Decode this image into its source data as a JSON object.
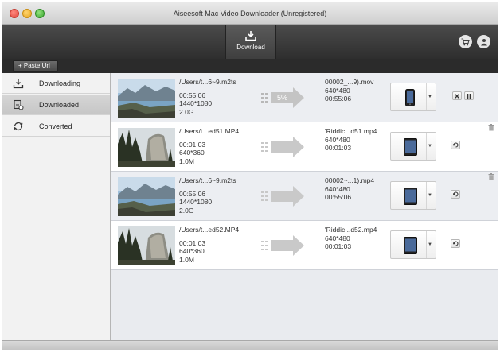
{
  "window": {
    "title": "Aiseesoft Mac Video Downloader (Unregistered)"
  },
  "toolbar": {
    "download_label": "Download"
  },
  "urlbar": {
    "paste_label": "Paste Url"
  },
  "sidebar": {
    "items": [
      {
        "label": "Downloading",
        "icon": "download-icon"
      },
      {
        "label": "Downloaded",
        "icon": "downloaded-icon"
      },
      {
        "label": "Converted",
        "icon": "convert-icon"
      }
    ],
    "active_index": 1
  },
  "rows": [
    {
      "thumb": "lake",
      "src": {
        "name": "/Users/t...6~9.m2ts",
        "duration": "00:55:06",
        "resolution": "1440*1080",
        "size": "2.0G"
      },
      "progress": "5%",
      "dst": {
        "name": "00002_...9).mov",
        "resolution": "640*480",
        "duration": "00:55:06"
      },
      "device": "iphone",
      "actions": [
        "stop",
        "pause"
      ],
      "deletable": false
    },
    {
      "thumb": "forest",
      "src": {
        "name": "/Users/t...ed51.MP4",
        "duration": "00:01:03",
        "resolution": "640*360",
        "size": "1.0M"
      },
      "progress": "",
      "dst": {
        "name": "'Riddic...d51.mp4",
        "resolution": "640*480",
        "duration": "00:01:03"
      },
      "device": "ipad",
      "actions": [
        "convert"
      ],
      "deletable": true
    },
    {
      "thumb": "lake",
      "src": {
        "name": "/Users/t...6~9.m2ts",
        "duration": "00:55:06",
        "resolution": "1440*1080",
        "size": "2.0G"
      },
      "progress": "",
      "dst": {
        "name": "00002~...1).mp4",
        "resolution": "640*480",
        "duration": "00:55:06"
      },
      "device": "ipad",
      "actions": [
        "convert"
      ],
      "deletable": true
    },
    {
      "thumb": "forest",
      "src": {
        "name": "/Users/t...ed52.MP4",
        "duration": "00:01:03",
        "resolution": "640*360",
        "size": "1.0M"
      },
      "progress": "",
      "dst": {
        "name": "'Riddic...d52.mp4",
        "resolution": "640*480",
        "duration": "00:01:03"
      },
      "device": "ipad",
      "actions": [
        "convert"
      ],
      "deletable": false
    }
  ]
}
